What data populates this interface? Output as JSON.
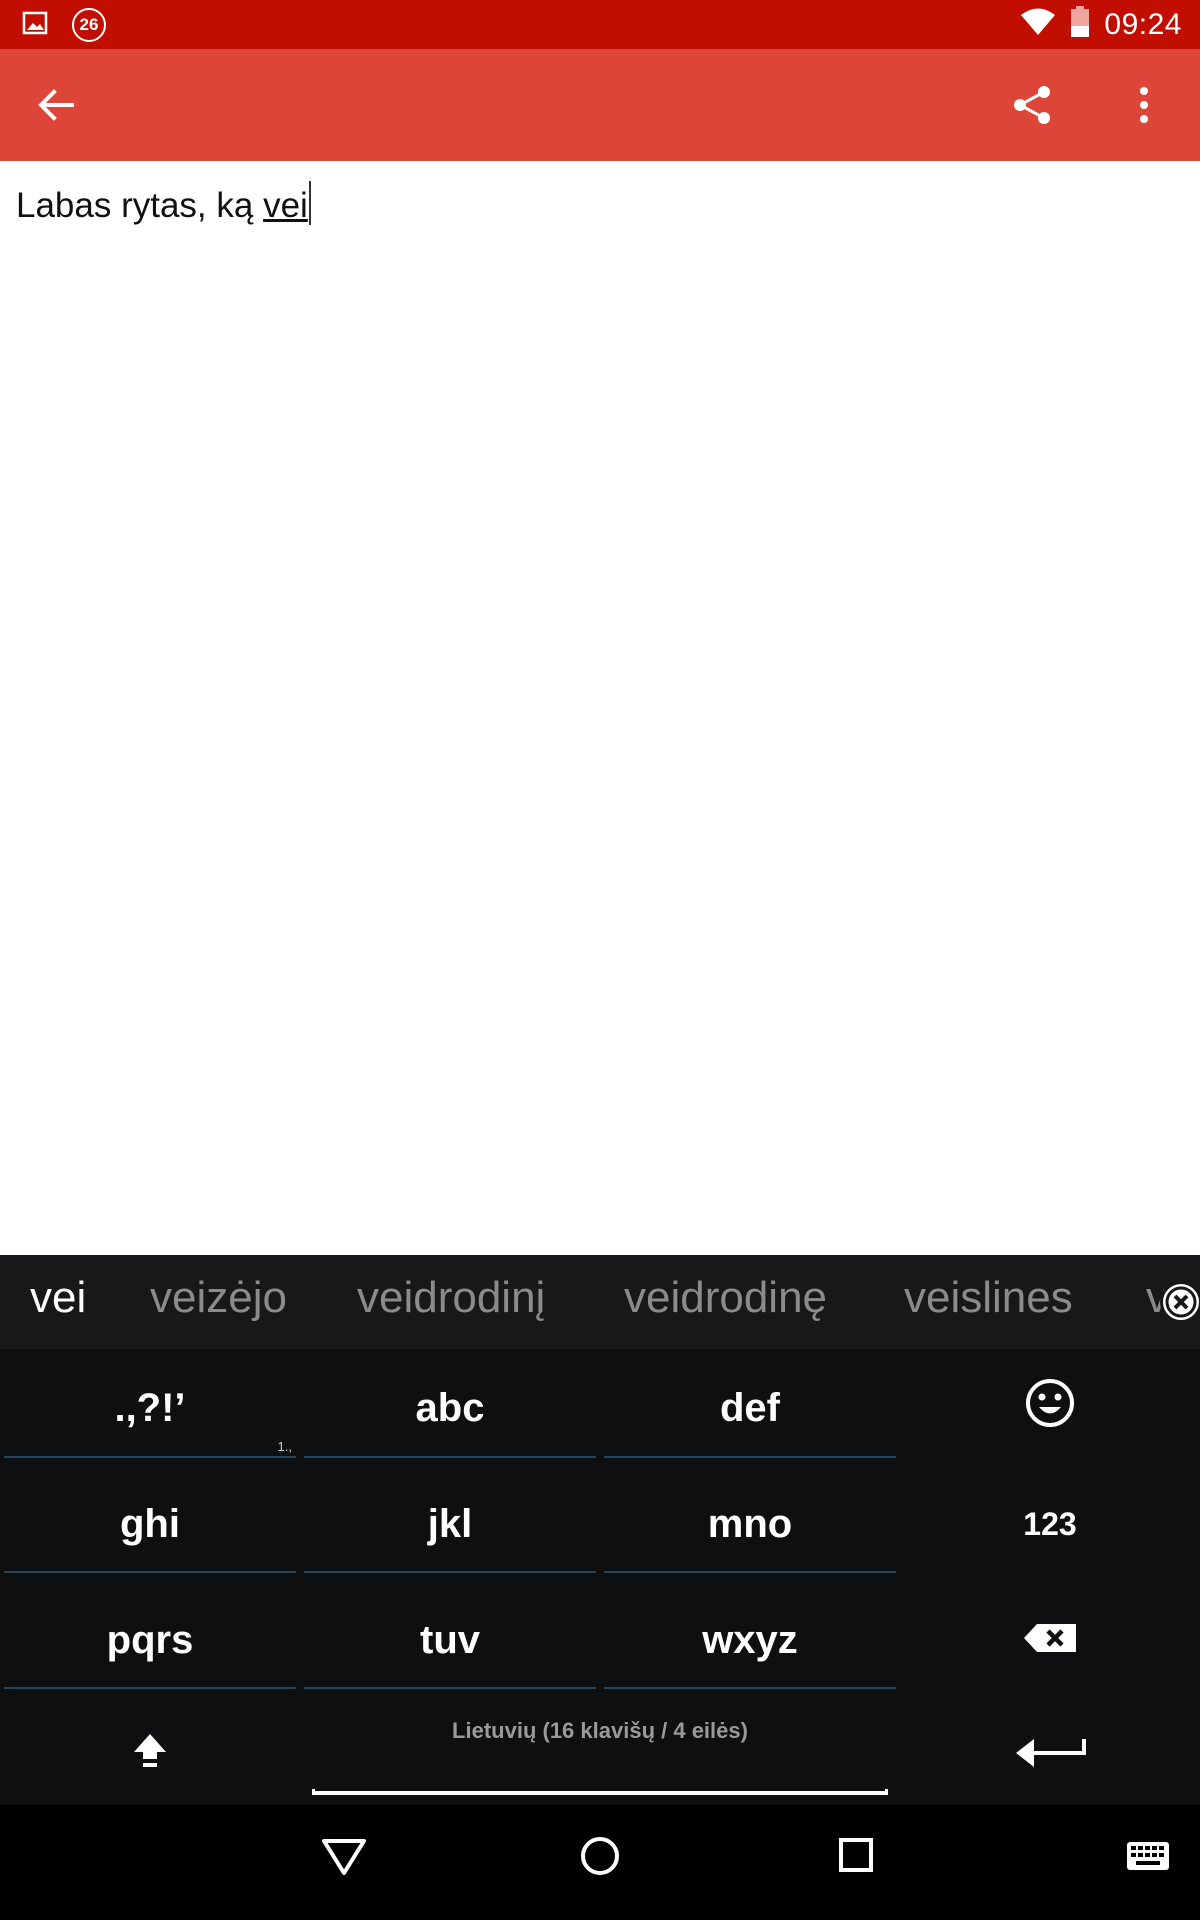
{
  "status_bar": {
    "notification_badge": "26",
    "time": "09:24",
    "icons": [
      "image-icon",
      "badge-26-icon",
      "wifi-icon",
      "battery-icon"
    ]
  },
  "app_bar": {
    "background": "#dd4538",
    "icons": [
      "back-arrow-icon",
      "share-icon",
      "overflow-menu-icon"
    ]
  },
  "editor": {
    "text_before": "Labas rytas, ką ",
    "composing_word": "vei"
  },
  "suggestions": {
    "items": [
      "vei",
      "veizėjo",
      "veidrodinį",
      "veidrodinę",
      "veislines",
      "v"
    ]
  },
  "keyboard": {
    "keys": {
      "punct": ".,?!’",
      "punct_hint": "1.,",
      "abc": "abc",
      "def": "def",
      "ghi": "ghi",
      "jkl": "jkl",
      "mno": "mno",
      "num": "123",
      "pqrs": "pqrs",
      "tuv": "tuv",
      "wxyz": "wxyz"
    },
    "space_label": "Lietuvių (16 klavišų / 4 eilės)",
    "icons": [
      "emoji-icon",
      "backspace-icon",
      "shift-icon",
      "enter-icon"
    ]
  },
  "nav_bar": {
    "icons": [
      "back-triangle-icon",
      "home-circle-icon",
      "recents-square-icon",
      "keyboard-switch-icon"
    ]
  }
}
